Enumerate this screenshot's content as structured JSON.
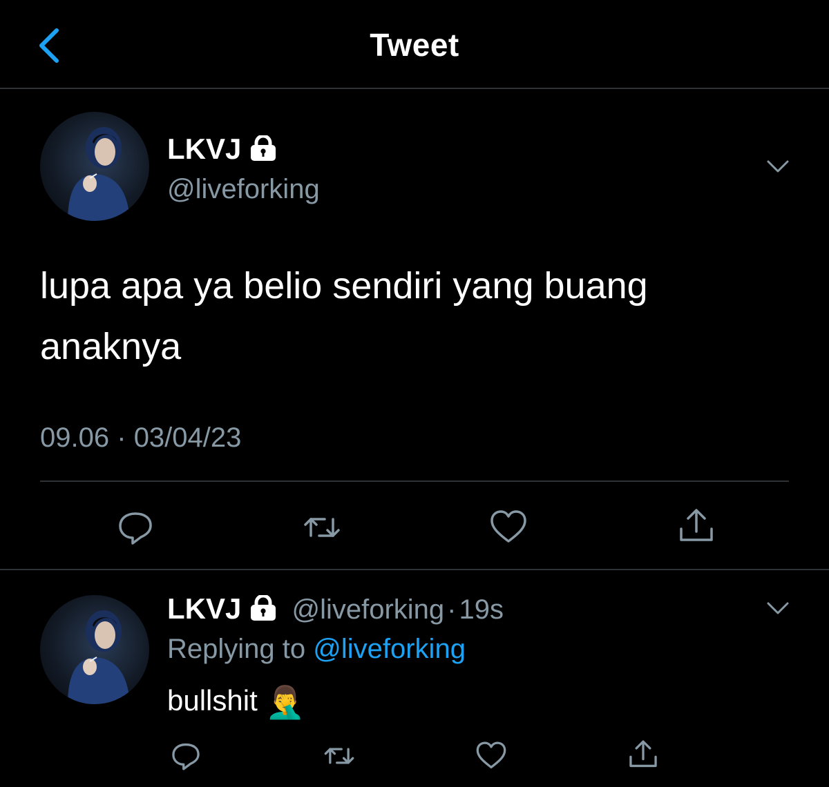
{
  "header": {
    "title": "Tweet",
    "back_icon": "chevron-left-icon",
    "accent_color": "#1da1f2"
  },
  "tweet": {
    "author_name": "LKVJ",
    "author_handle": "@liveforking",
    "protected_icon": "lock-icon",
    "text": "lupa apa ya belio sendiri yang buang anaknya",
    "time": "09.06",
    "separator": "·",
    "date": "03/04/23",
    "actions": [
      "reply-icon",
      "retweet-icon",
      "like-icon",
      "share-icon"
    ]
  },
  "reply": {
    "author_name": "LKVJ",
    "author_handle": "@liveforking",
    "separator": "·",
    "age": "19s",
    "replying_prefix": "Replying to",
    "replying_handle": "@liveforking",
    "text": "bullshit",
    "emoji": "🤦‍♂️",
    "actions": [
      "reply-icon",
      "retweet-icon",
      "like-icon",
      "share-icon"
    ]
  }
}
